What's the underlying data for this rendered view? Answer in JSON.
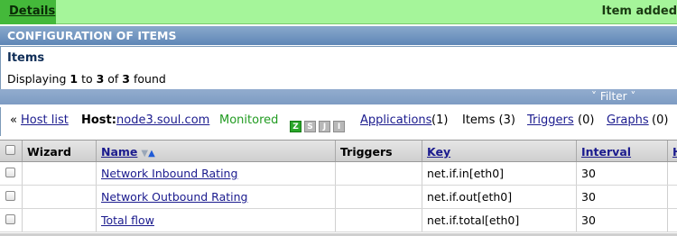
{
  "message": {
    "details_label": "Details",
    "text": "Item added"
  },
  "config_header": "CONFIGURATION OF ITEMS",
  "items_header": {
    "title": "Items",
    "display_prefix": "Displaying ",
    "from": "1",
    "to_word": " to ",
    "to": "3",
    "of_word": " of ",
    "total": "3",
    "found_word": " found"
  },
  "filter": {
    "label": "˅ Filter ˅"
  },
  "host_nav": {
    "back_prefix": "« ",
    "host_list": "Host list",
    "host_label": "Host:",
    "host_name": "node3.soul.com",
    "status": "Monitored",
    "badges": [
      "Z",
      "S",
      "J",
      "I"
    ],
    "applications_label": "Applications",
    "applications_count": "(1)",
    "items_label": "Items (3)",
    "triggers_label": "Triggers",
    "triggers_count": "(0)",
    "graphs_label": "Graphs",
    "graphs_count": "(0)"
  },
  "table": {
    "columns": [
      "Wizard",
      "Name",
      "Triggers",
      "Key",
      "Interval",
      "H"
    ],
    "rows": [
      {
        "name": "Network Inbound Rating",
        "triggers": "",
        "key": "net.if.in[eth0]",
        "interval": "30"
      },
      {
        "name": "Network Outbound Rating",
        "triggers": "",
        "key": "net.if.out[eth0]",
        "interval": "30"
      },
      {
        "name": "Total flow",
        "triggers": "",
        "key": "net.if.total[eth0]",
        "interval": "30"
      }
    ]
  }
}
